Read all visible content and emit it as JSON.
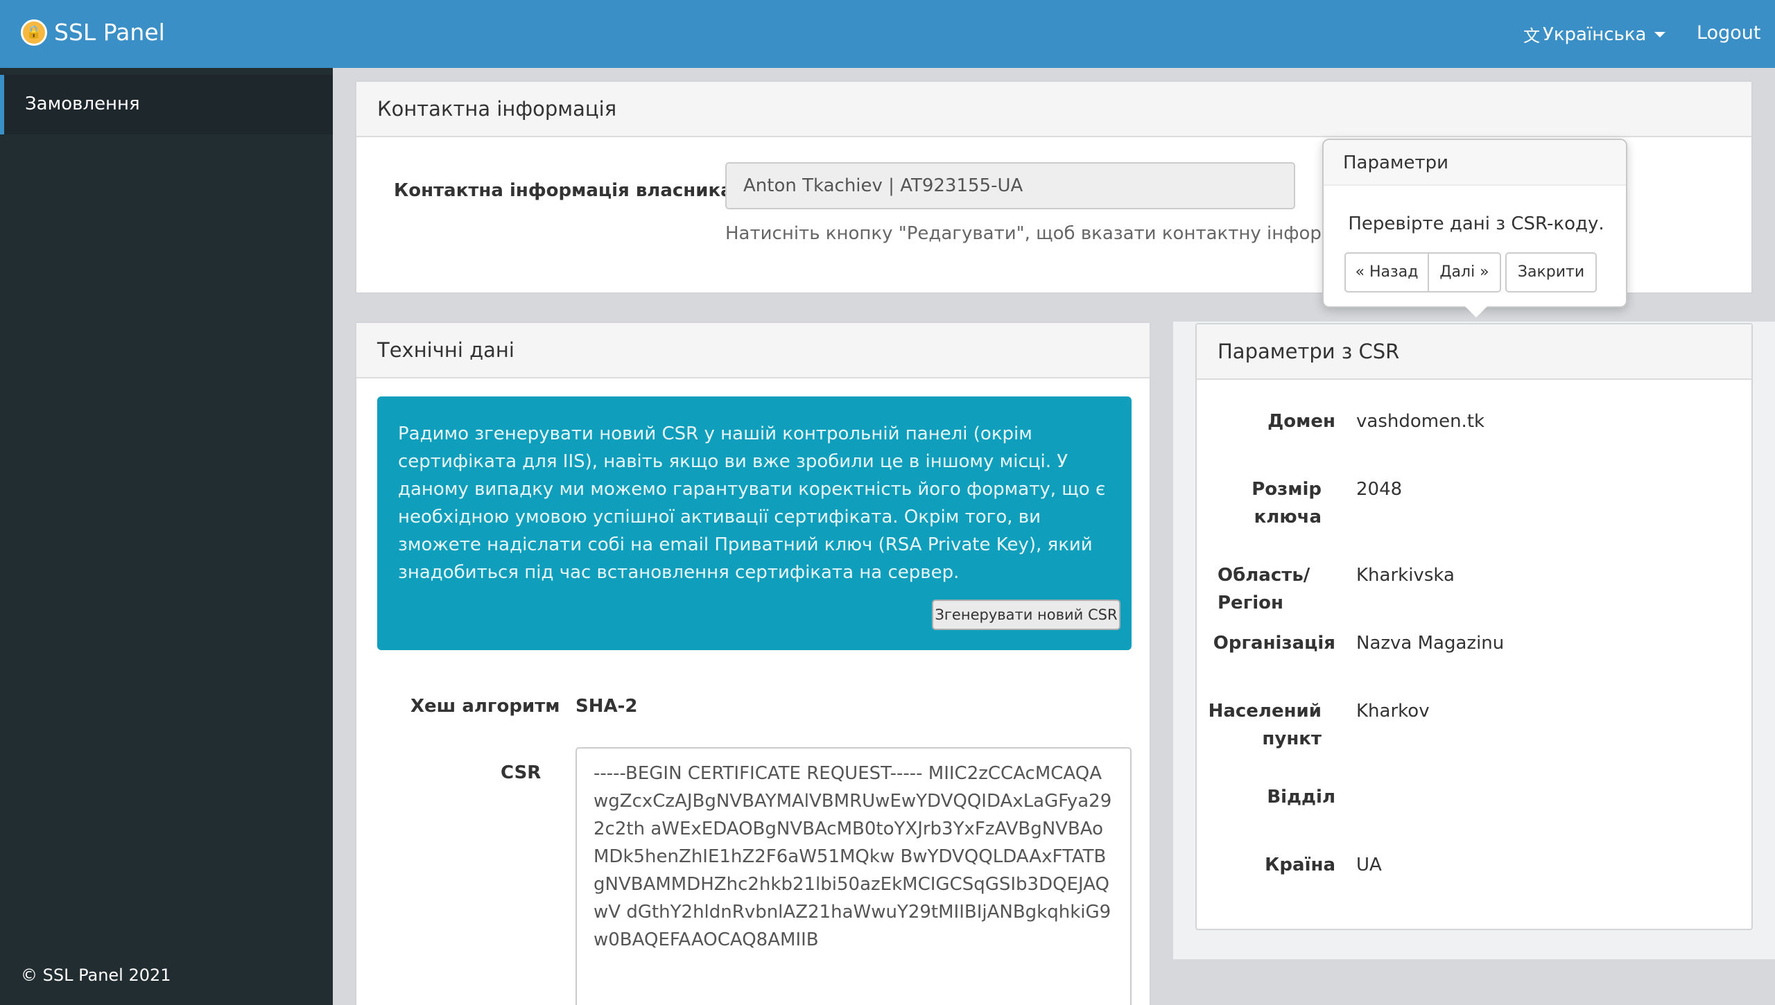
{
  "navbar": {
    "brand": "SSL Panel",
    "language": "Українська",
    "logout": "Logout"
  },
  "sidebar": {
    "items": [
      {
        "label": "Замовлення"
      }
    ],
    "copyright": "© SSL Panel 2021"
  },
  "contact": {
    "title": "Контактна інформація",
    "owner_label": "Контактна інформація власника",
    "owner_value": "Anton Tkachiev | AT923155-UA",
    "help": "Натисніть кнопку \"Редагувати\", щоб вказати контактну інформацію вл"
  },
  "tech": {
    "title": "Технічні дані",
    "alert": "Радимо згенерувати новий CSR у нашій контрольній панелі (окрім сертифіката для IIS), навіть якщо ви вже зробили це в іншому місці. У даному випадку ми можемо гарантувати коректність його формату, що є необхідною умовою успішної активації сертифіката. Окрім того, ви зможете надіслати собі на email Приватний ключ (RSA Private Key), який знадобиться під час встановлення сертифіката на сервер.",
    "generate_button": "Згенерувати новий CSR",
    "hash_label": "Хеш алгоритм",
    "hash_value": "SHA-2",
    "csr_label": "CSR",
    "csr_value": "-----BEGIN CERTIFICATE REQUEST----- MIIC2zCCAcMCAQAwgZcxCzAJBgNVBAYMAlVBMRUwEwYDVQQIDAxLaGFya292c2th aWExEDAOBgNVBAcMB0toYXJrb3YxFzAVBgNVBAoMDk5henZhIE1hZ2F6aW51MQkw BwYDVQQLDAAxFTATBgNVBAMMDHZhc2hkb21lbi50azEkMCIGCSqGSIb3DQEJAQwV dGthY2hldnRvbnlAZ21haWwuY29tMIIBIjANBgkqhkiG9w0BAQEFAAOCAQ8AMIIB"
  },
  "params": {
    "title": "Параметри з CSR",
    "rows": [
      {
        "label": "Домен",
        "value": "vashdomen.tk"
      },
      {
        "label": "Розмір ключа",
        "value": "2048"
      },
      {
        "label": "Область/Регіон",
        "value": "Kharkivska"
      },
      {
        "label": "Організація",
        "value": "Nazva Magazinu"
      },
      {
        "label": "Населений пункт",
        "value": "Kharkov"
      },
      {
        "label": "Відділ",
        "value": ""
      },
      {
        "label": "Країна",
        "value": "UA"
      }
    ]
  },
  "popover": {
    "title": "Параметри",
    "content": "Перевірте дані з CSR-коду.",
    "back": "« Назад",
    "next": "Далі »",
    "close": "Закрити"
  }
}
